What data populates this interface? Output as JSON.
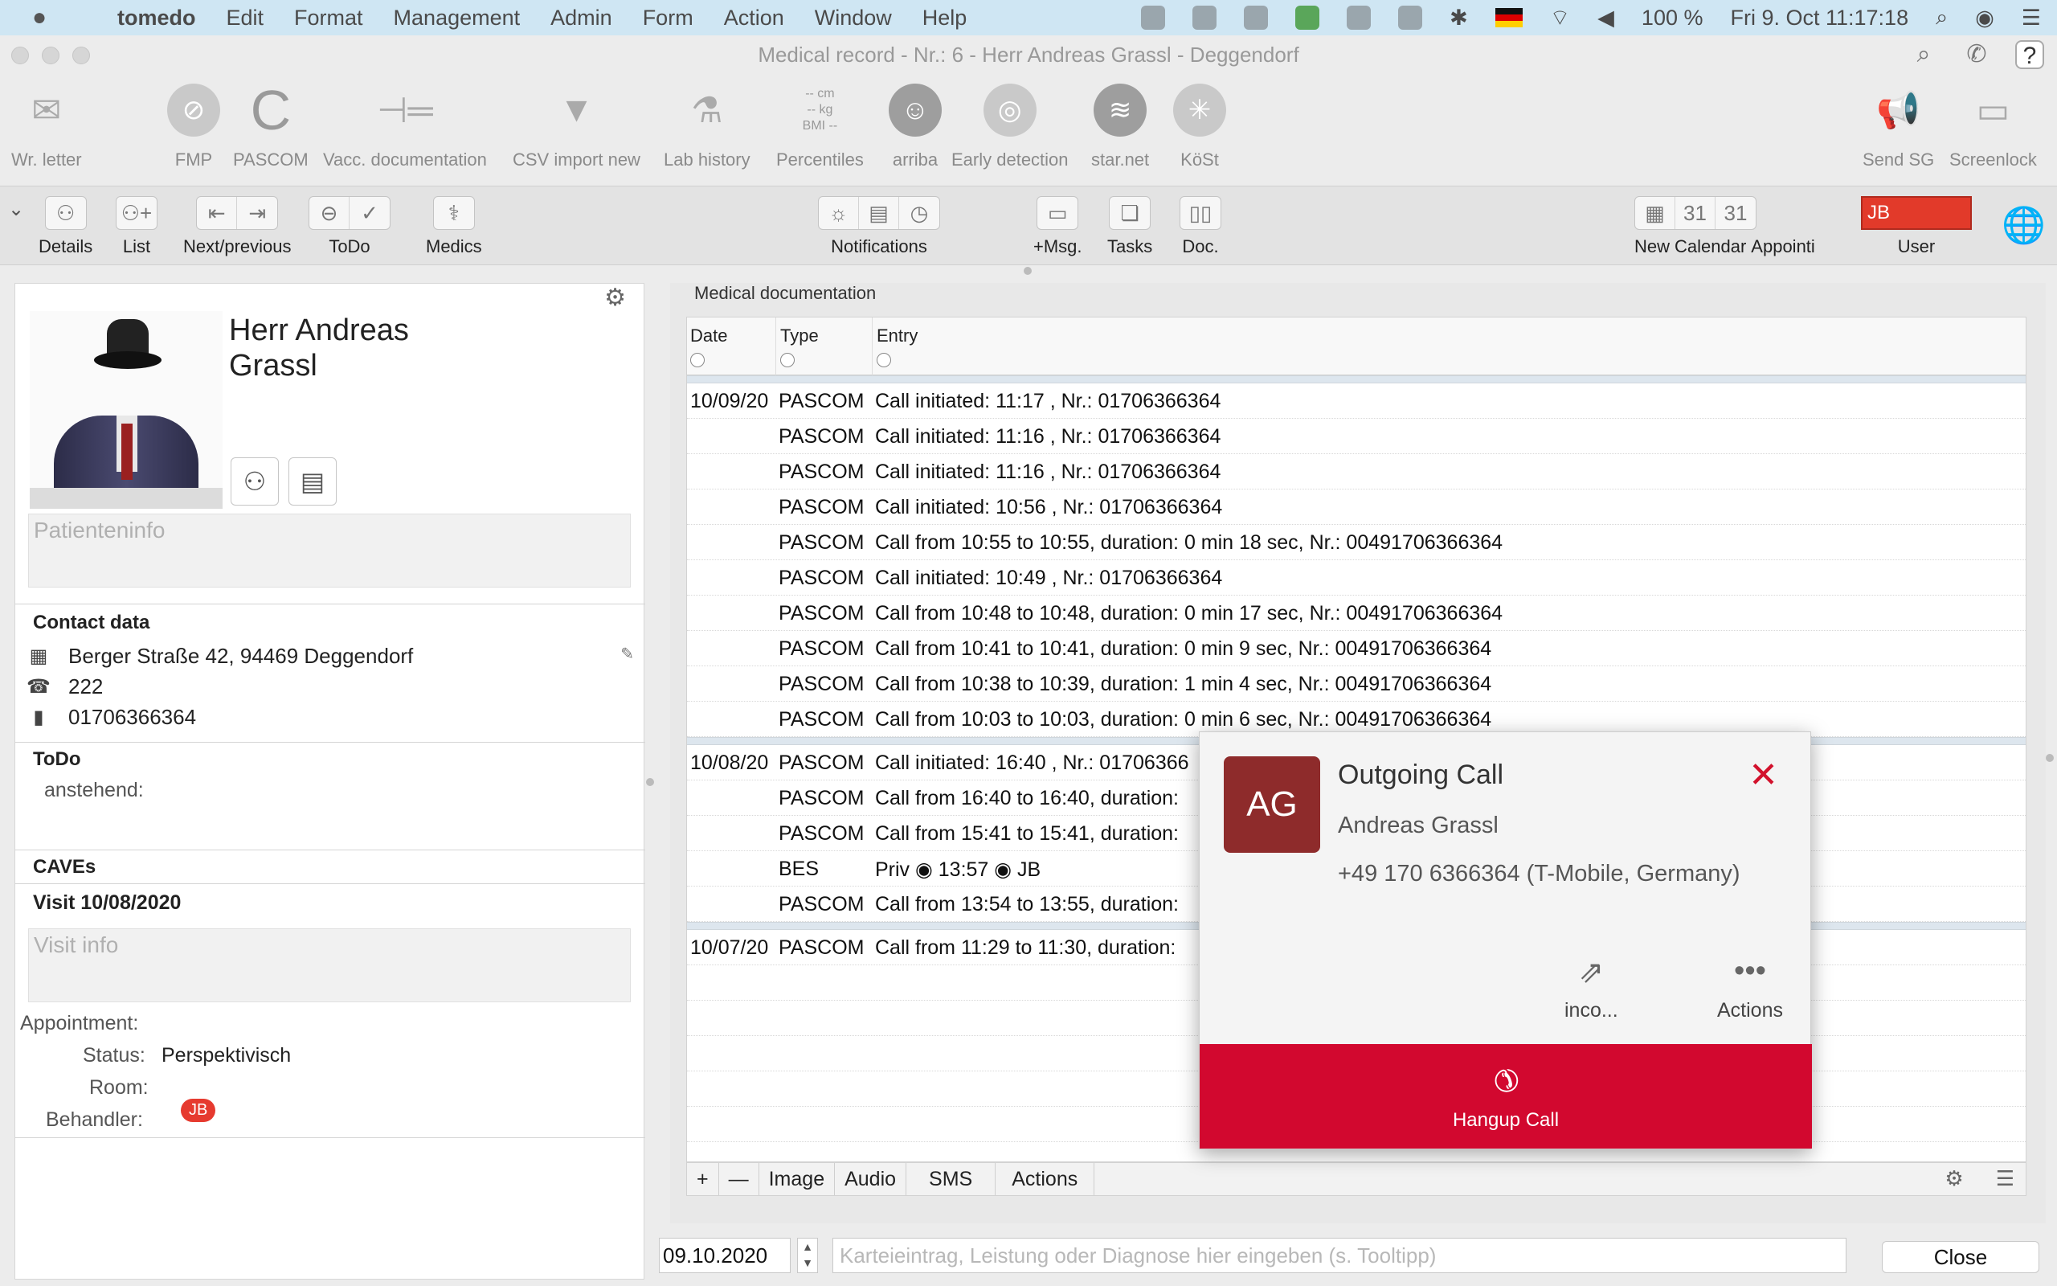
{
  "menubar": {
    "app_name": "tomedo",
    "items": [
      "Edit",
      "Format",
      "Management",
      "Admin",
      "Form",
      "Action",
      "Window",
      "Help"
    ],
    "battery": "100 %",
    "datetime": "Fri 9. Oct  11:17:18"
  },
  "window": {
    "title": "Medical record - Nr.: 6 - Herr Andreas Grassl - Deggendorf"
  },
  "toolbar": {
    "items": [
      {
        "label": "Wr. letter",
        "icon": "letter-plus-icon"
      },
      {
        "label": "FMP",
        "icon": "pill-icon"
      },
      {
        "label": "PASCOM",
        "icon": "pascom-logo-icon"
      },
      {
        "label": "Vacc. documentation",
        "icon": "syringe-icon"
      },
      {
        "label": "CSV import new",
        "icon": "funnel-icon"
      },
      {
        "label": "Lab history",
        "icon": "flask-icon"
      },
      {
        "label": "Percentiles",
        "icon": "percentiles-icon"
      },
      {
        "label": "arriba",
        "icon": "smiley-icon"
      },
      {
        "label": "Early detection",
        "icon": "radar-icon"
      },
      {
        "label": "star.net",
        "icon": "dna-icon"
      },
      {
        "label": "KöSt",
        "icon": "vitruvian-icon"
      },
      {
        "label": "Send SG",
        "icon": "megaphone-icon"
      },
      {
        "label": "Screenlock",
        "icon": "screen-lock-icon"
      }
    ],
    "percentiles_lines": [
      "-- cm",
      "-- kg",
      "BMI --"
    ]
  },
  "toolbar2": {
    "details": "Details",
    "list": "List",
    "next_prev": "Next/previous",
    "todo": "ToDo",
    "medics": "Medics",
    "notifications": "Notifications",
    "msg": "+Msg.",
    "tasks": "Tasks",
    "doc": "Doc.",
    "new": "New",
    "calendar": "Calendar",
    "appointment": "Appointi",
    "user": "User",
    "user_value": "JB"
  },
  "patient": {
    "name_line1": "Herr Andreas",
    "name_line2": "Grassl",
    "info_placeholder": "Patienteninfo",
    "contact_heading": "Contact data",
    "address": "Berger Straße 42, 94469 Deggendorf",
    "phone": "222",
    "mobile": "01706366364",
    "todo_heading": "ToDo",
    "todo_pending": "anstehend:",
    "caves_heading": "CAVEs",
    "visit_heading": "Visit 10/08/2020",
    "visit_placeholder": "Visit info",
    "appointment_label": "Appointment:",
    "status_label": "Status:",
    "status_value": "Perspektivisch",
    "room_label": "Room:",
    "behandler_label": "Behandler:",
    "behandler_value": "JB"
  },
  "documentation": {
    "title": "Medical documentation",
    "columns": [
      "Date",
      "Type",
      "Entry"
    ],
    "groups": [
      {
        "date": "10/09/20",
        "rows": [
          {
            "type": "PASCOM",
            "entry": "Call initiated: 11:17 , Nr.: 01706366364"
          },
          {
            "type": "PASCOM",
            "entry": "Call initiated: 11:16 , Nr.: 01706366364"
          },
          {
            "type": "PASCOM",
            "entry": "Call initiated: 11:16 , Nr.: 01706366364"
          },
          {
            "type": "PASCOM",
            "entry": "Call initiated: 10:56 , Nr.: 01706366364"
          },
          {
            "type": "PASCOM",
            "entry": "Call from 10:55 to 10:55, duration: 0 min 18 sec, Nr.: 00491706366364"
          },
          {
            "type": "PASCOM",
            "entry": "Call initiated: 10:49 , Nr.: 01706366364"
          },
          {
            "type": "PASCOM",
            "entry": "Call from 10:48 to 10:48, duration: 0 min 17 sec, Nr.: 00491706366364"
          },
          {
            "type": "PASCOM",
            "entry": "Call from 10:41 to 10:41, duration: 0 min 9 sec, Nr.: 00491706366364"
          },
          {
            "type": "PASCOM",
            "entry": "Call from 10:38 to 10:39, duration: 1 min 4 sec, Nr.: 00491706366364"
          },
          {
            "type": "PASCOM",
            "entry": "Call from 10:03 to 10:03, duration: 0 min 6 sec, Nr.: 00491706366364"
          }
        ]
      },
      {
        "date": "10/08/20",
        "rows": [
          {
            "type": "PASCOM",
            "entry": "Call initiated: 16:40 , Nr.: 01706366"
          },
          {
            "type": "PASCOM",
            "entry": "Call from 16:40 to 16:40, duration:"
          },
          {
            "type": "PASCOM",
            "entry": "Call from 15:41 to 15:41, duration:"
          },
          {
            "type": "BES",
            "entry": "Priv ◉ 13:57 ◉ JB"
          },
          {
            "type": "PASCOM",
            "entry": "Call from 13:54 to 13:55, duration:"
          }
        ]
      },
      {
        "date": "10/07/20",
        "rows": [
          {
            "type": "PASCOM",
            "entry": "Call from 11:29 to 11:30, duration:"
          }
        ]
      }
    ],
    "bottom_buttons": [
      "+",
      "—",
      "Image",
      "Audio",
      "SMS",
      "Actions"
    ]
  },
  "entry": {
    "date_value": "09.10.2020",
    "placeholder": "Karteieintrag, Leistung oder Diagnose hier eingeben (s. Tooltipp)",
    "close_label": "Close"
  },
  "call_popup": {
    "initials": "AG",
    "title": "Outgoing Call",
    "name": "Andreas Grassl",
    "number": "+49 170 6366364 (T-Mobile, Germany)",
    "action1": "inco...",
    "action2": "Actions",
    "hangup": "Hangup Call",
    "accent": "#d2082f"
  }
}
